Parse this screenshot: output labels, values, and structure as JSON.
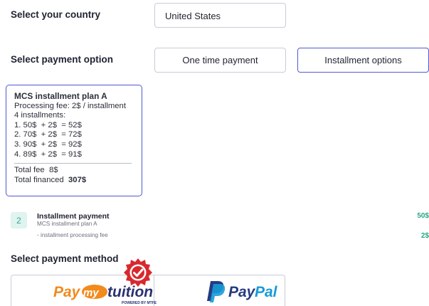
{
  "country": {
    "label": "Select your country",
    "value": "United States"
  },
  "payment_option": {
    "label": "Select payment option",
    "options": [
      "One time payment",
      "Installment options"
    ],
    "selected": "Installment options"
  },
  "plan": {
    "title": "MCS installment plan A",
    "processing_fee": "Processing fee: 2$ / installment",
    "count": "4 installments:",
    "items": [
      "1. 50$  + 2$  = 52$",
      "2. 70$  + 2$  = 72$",
      "3. 90$  + 2$  = 92$",
      "4. 89$  + 2$  = 91$"
    ],
    "total_fee": "Total fee  8$",
    "total_financed_label": "Total financed",
    "total_financed_value": "307$"
  },
  "summary": {
    "step": "2",
    "title": "Installment payment",
    "subtitle": "MCS installment plan A",
    "fee_label": "- installment processing fee",
    "amount": "50$",
    "fee_amount": "2$"
  },
  "method": {
    "label": "Select payment method",
    "options": [
      "Paymytuition",
      "PayPal"
    ],
    "paymytuition_tagline": "POWERED BY MTFE"
  },
  "colors": {
    "accent": "#5059d4",
    "success": "#2aa586",
    "badge_red": "#d8292f"
  }
}
